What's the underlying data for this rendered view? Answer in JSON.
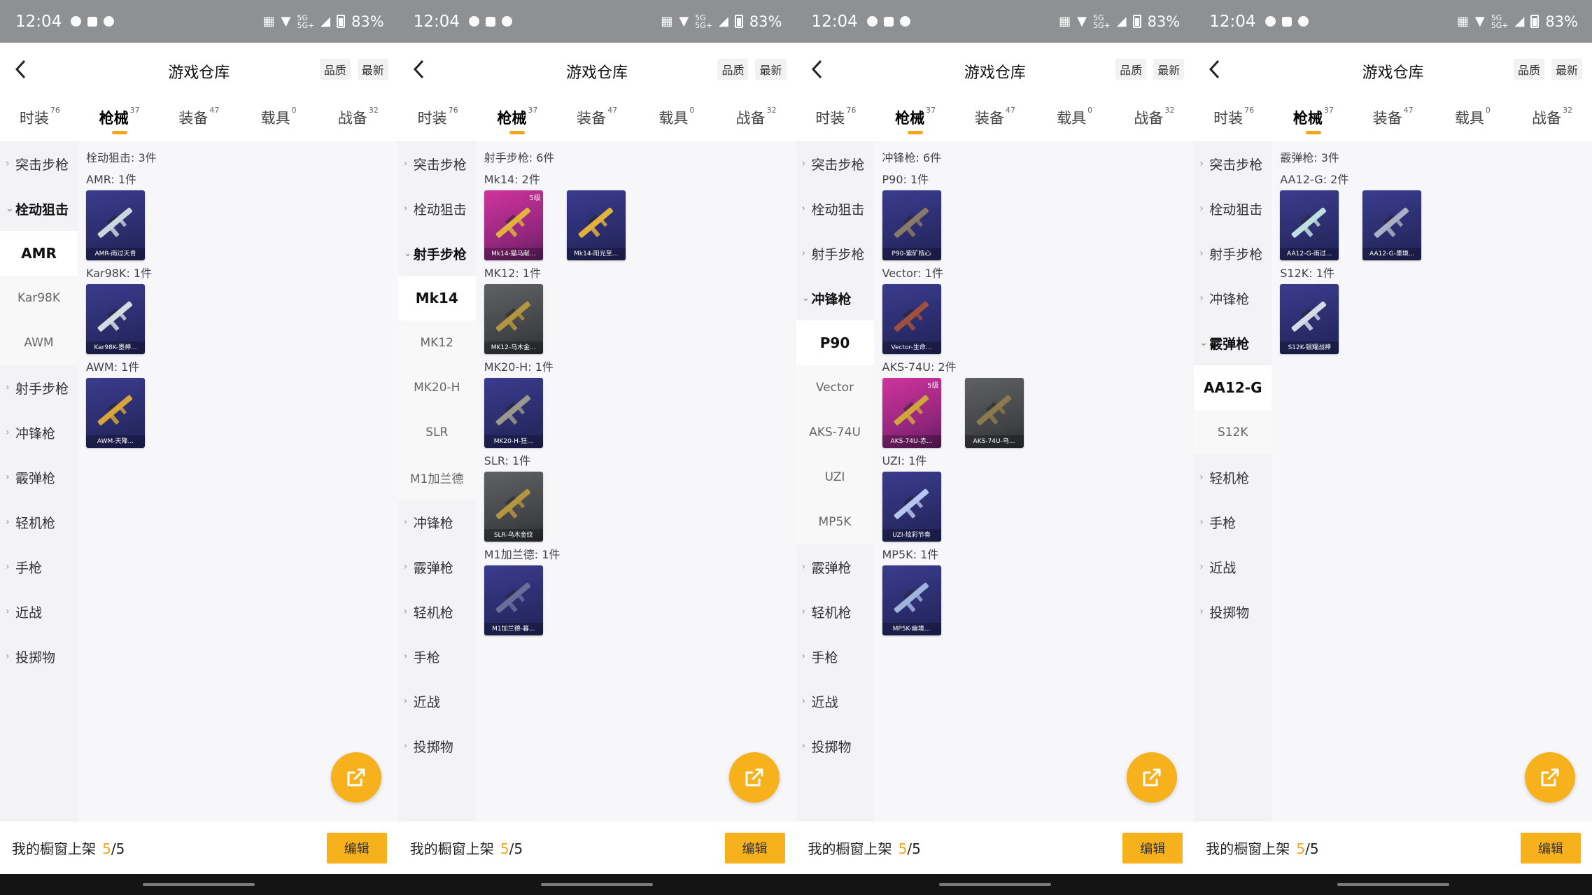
{
  "statusbar": {
    "time": "12:04",
    "net1": "5G",
    "net2": "5G+",
    "battery": "83%"
  },
  "header": {
    "title": "游戏仓库",
    "sort_quality": "品质",
    "sort_newest": "最新"
  },
  "tabs": [
    {
      "label": "时装",
      "count": "76"
    },
    {
      "label": "枪械",
      "count": "37"
    },
    {
      "label": "装备",
      "count": "47"
    },
    {
      "label": "载具",
      "count": "0"
    },
    {
      "label": "战备",
      "count": "32"
    }
  ],
  "active_tab_index": 1,
  "bottom": {
    "label": "我的橱窗上架",
    "count_value": "5",
    "count_total": "/5",
    "edit_label": "编辑"
  },
  "colors": {
    "accent": "#f6b11d",
    "statusbar": "#8f9092"
  },
  "icons": {
    "back": "chevron-left-icon",
    "share": "share-out-icon"
  },
  "panels": [
    {
      "sidebar": [
        {
          "type": "cat",
          "label": "突击步枪"
        },
        {
          "type": "cat",
          "label": "栓动狙击",
          "open": true
        },
        {
          "type": "sub",
          "label": "AMR",
          "active": true
        },
        {
          "type": "sub",
          "label": "Kar98K"
        },
        {
          "type": "sub",
          "label": "AWM"
        },
        {
          "type": "cat",
          "label": "射手步枪"
        },
        {
          "type": "cat",
          "label": "冲锋枪"
        },
        {
          "type": "cat",
          "label": "霰弹枪"
        },
        {
          "type": "cat",
          "label": "轻机枪"
        },
        {
          "type": "cat",
          "label": "手枪"
        },
        {
          "type": "cat",
          "label": "近战"
        },
        {
          "type": "cat",
          "label": "投掷物"
        }
      ],
      "content": {
        "group_title": "栓动狙击: 3件",
        "items": [
          {
            "title": "AMR: 1件",
            "cards": [
              {
                "name": "AMR-雨过天青",
                "color": "purple",
                "gun": "#c9d8dc"
              }
            ]
          },
          {
            "title": "Kar98K: 1件",
            "cards": [
              {
                "name": "Kar98K-墨神...",
                "color": "purple",
                "gun": "#d6dde2"
              }
            ]
          },
          {
            "title": "AWM: 1件",
            "cards": [
              {
                "name": "AWM-天降...",
                "color": "purple",
                "gun": "#d7a53a"
              }
            ]
          }
        ]
      }
    },
    {
      "sidebar": [
        {
          "type": "cat",
          "label": "突击步枪"
        },
        {
          "type": "cat",
          "label": "栓动狙击"
        },
        {
          "type": "cat",
          "label": "射手步枪",
          "open": true
        },
        {
          "type": "sub",
          "label": "Mk14",
          "active": true
        },
        {
          "type": "sub",
          "label": "MK12"
        },
        {
          "type": "sub",
          "label": "MK20-H"
        },
        {
          "type": "sub",
          "label": "SLR"
        },
        {
          "type": "sub",
          "label": "M1加兰德"
        },
        {
          "type": "cat",
          "label": "冲锋枪"
        },
        {
          "type": "cat",
          "label": "霰弹枪"
        },
        {
          "type": "cat",
          "label": "轻机枪"
        },
        {
          "type": "cat",
          "label": "手枪"
        },
        {
          "type": "cat",
          "label": "近战"
        },
        {
          "type": "cat",
          "label": "投掷物"
        }
      ],
      "content": {
        "group_title": "射手步枪: 6件",
        "items": [
          {
            "title": "Mk14: 2件",
            "cards": [
              {
                "name": "Mk14-猫马献...",
                "color": "pink",
                "lvl": "5级",
                "gun": "#e3b23c"
              },
              {
                "name": "Mk14-阳光至...",
                "color": "purple",
                "gun": "#e3b23c"
              }
            ]
          },
          {
            "title": "MK12: 1件",
            "cards": [
              {
                "name": "MK12-乌木金...",
                "color": "dark",
                "gun": "#b49540"
              }
            ]
          },
          {
            "title": "MK20-H: 1件",
            "cards": [
              {
                "name": "MK20-H-狂...",
                "color": "purple",
                "gun": "#9a9a8c"
              }
            ]
          },
          {
            "title": "SLR: 1件",
            "cards": [
              {
                "name": "SLR-乌木金纹",
                "color": "dark",
                "gun": "#b49540"
              }
            ]
          },
          {
            "title": "M1加兰德: 1件",
            "cards": [
              {
                "name": "M1加兰德-暮...",
                "color": "purple",
                "gun": "#6a6f9a"
              }
            ]
          }
        ]
      }
    },
    {
      "sidebar": [
        {
          "type": "cat",
          "label": "突击步枪"
        },
        {
          "type": "cat",
          "label": "栓动狙击"
        },
        {
          "type": "cat",
          "label": "射手步枪"
        },
        {
          "type": "cat",
          "label": "冲锋枪",
          "open": true
        },
        {
          "type": "sub",
          "label": "P90",
          "active": true
        },
        {
          "type": "sub",
          "label": "Vector"
        },
        {
          "type": "sub",
          "label": "AKS-74U"
        },
        {
          "type": "sub",
          "label": "UZI"
        },
        {
          "type": "sub",
          "label": "MP5K"
        },
        {
          "type": "cat",
          "label": "霰弹枪"
        },
        {
          "type": "cat",
          "label": "轻机枪"
        },
        {
          "type": "cat",
          "label": "手枪"
        },
        {
          "type": "cat",
          "label": "近战"
        },
        {
          "type": "cat",
          "label": "投掷物"
        }
      ],
      "content": {
        "group_title": "冲锋枪: 6件",
        "items": [
          {
            "title": "P90: 1件",
            "cards": [
              {
                "name": "P90-紫矿核心",
                "color": "purple",
                "gun": "#8a7a6a"
              }
            ]
          },
          {
            "title": "Vector: 1件",
            "cards": [
              {
                "name": "Vector-生命...",
                "color": "purple",
                "gun": "#a0503e"
              }
            ]
          },
          {
            "title": "AKS-74U: 2件",
            "cards": [
              {
                "name": "AKS-74U-赤...",
                "color": "pink",
                "lvl": "5级",
                "gun": "#d2a63a"
              },
              {
                "name": "AKS-74U-乌...",
                "color": "dark",
                "gun": "#8c7b4a"
              }
            ]
          },
          {
            "title": "UZI: 1件",
            "cards": [
              {
                "name": "UZI-炫彩节奏",
                "color": "purple",
                "gun": "#b7c6ee"
              }
            ]
          },
          {
            "title": "MP5K: 1件",
            "cards": [
              {
                "name": "MP5K-幽境...",
                "color": "purple",
                "gun": "#9fb3dc"
              }
            ]
          }
        ]
      }
    },
    {
      "sidebar": [
        {
          "type": "cat",
          "label": "突击步枪"
        },
        {
          "type": "cat",
          "label": "栓动狙击"
        },
        {
          "type": "cat",
          "label": "射手步枪"
        },
        {
          "type": "cat",
          "label": "冲锋枪"
        },
        {
          "type": "cat",
          "label": "霰弹枪",
          "open": true
        },
        {
          "type": "sub",
          "label": "AA12-G",
          "active": true
        },
        {
          "type": "sub",
          "label": "S12K"
        },
        {
          "type": "cat",
          "label": "轻机枪"
        },
        {
          "type": "cat",
          "label": "手枪"
        },
        {
          "type": "cat",
          "label": "近战"
        },
        {
          "type": "cat",
          "label": "投掷物"
        }
      ],
      "content": {
        "group_title": "霰弹枪: 3件",
        "items": [
          {
            "title": "AA12-G: 2件",
            "cards": [
              {
                "name": "AA12-G-雨过...",
                "color": "purple",
                "gun": "#bfe0df"
              },
              {
                "name": "AA12-G-墨境...",
                "color": "purple",
                "gun": "#aab0c6"
              }
            ]
          },
          {
            "title": "S12K: 1件",
            "cards": [
              {
                "name": "S12K-银耀战神",
                "color": "purple",
                "gun": "#d5dce6"
              }
            ]
          }
        ]
      }
    }
  ]
}
